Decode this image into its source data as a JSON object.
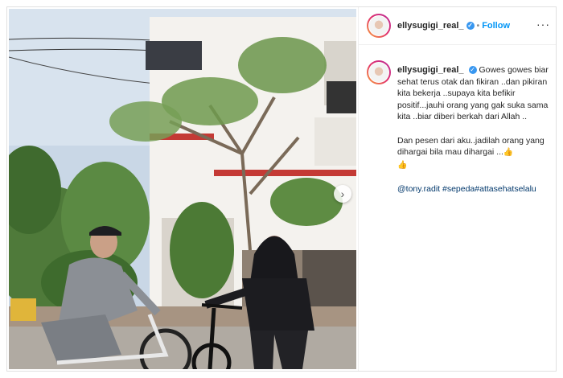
{
  "post": {
    "username": "ellysugigi_real_",
    "follow_label": "Follow",
    "separator": "•",
    "more_label": "···",
    "next_label": "›"
  },
  "caption": {
    "username": "ellysugigi_real_",
    "line1": "Gowes gowes biar sehat terus otak dan fikiran ..dan pikiran kita bekerja ..supaya kita befikir positif...jauhi orang yang gak suka sama kita ..biar diberi berkah dari Allah ..",
    "line2": "Dan pesen dari aku..jadilah orang yang dihargai bila mau dihargai ...",
    "emoji": "👍",
    "tags": "@tony.radit #sepeda#attasehatselalu"
  },
  "colors": {
    "accent": "#0095f6",
    "verified": "#3897f0",
    "text": "#262626"
  },
  "icons": {
    "verified": "verified-badge-icon",
    "more": "more-options-icon",
    "next": "chevron-right-icon"
  }
}
